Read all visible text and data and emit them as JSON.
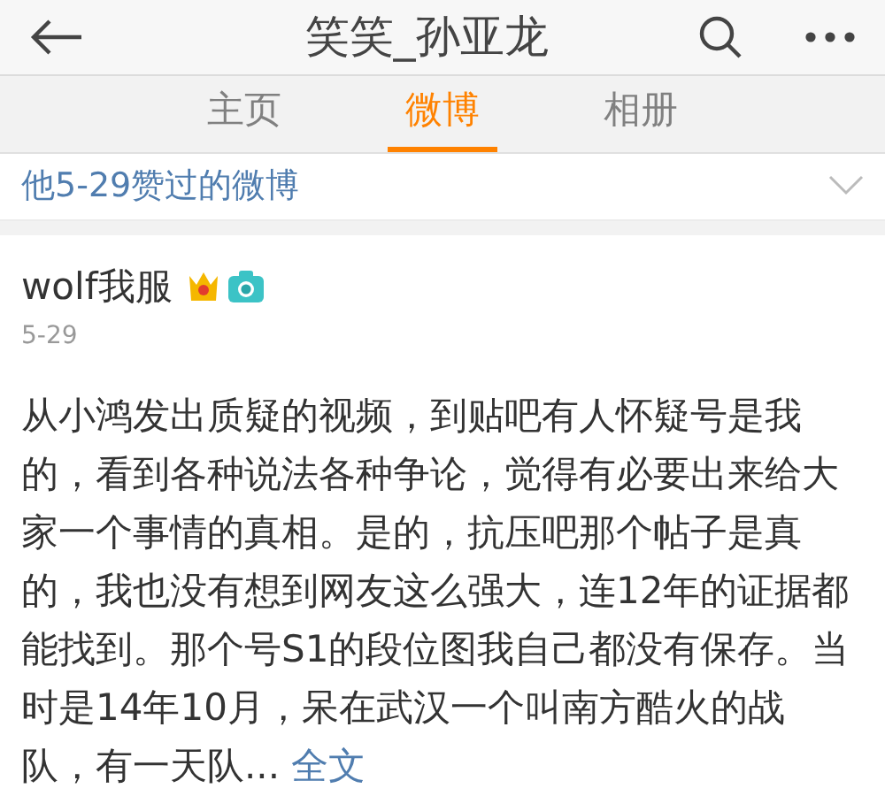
{
  "header": {
    "title": "笑笑_孙亚龙"
  },
  "tabs": [
    {
      "label": "主页",
      "selected": false
    },
    {
      "label": "微博",
      "selected": true
    },
    {
      "label": "相册",
      "selected": false
    }
  ],
  "filter": {
    "label": "他5-29赞过的微博",
    "expanded": false
  },
  "post": {
    "author": "wolf我服",
    "date": "5-29",
    "text": "从小鸿发出质疑的视频，到贴吧有人怀疑号是我的，看到各种说法各种争论，觉得有必要出来给大家一个事情的真相。是的，抗压吧那个帖子是真的，我也没有想到网友这么强大，连12年的证据都能找到。那个号S1的段位图我自己都没有保存。当时是14年10月，呆在武汉一个叫南方酷火的战队，有一天队...",
    "more": "全文"
  }
}
